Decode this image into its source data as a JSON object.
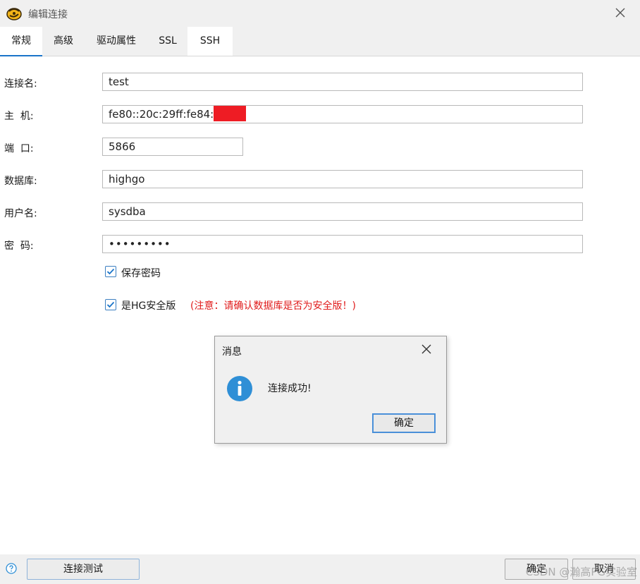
{
  "window": {
    "title": "编辑连接",
    "close_icon": "close-icon"
  },
  "tabs": [
    {
      "label": "常规",
      "active": true
    },
    {
      "label": "高级"
    },
    {
      "label": "驱动属性"
    },
    {
      "label": "SSL"
    },
    {
      "label": "SSH"
    }
  ],
  "form": {
    "conn_name": {
      "label": "连接名:",
      "value": "test"
    },
    "host": {
      "label": "主  机:",
      "value": "fe80::20c:29ff:fe84:"
    },
    "port": {
      "label": "端  口:",
      "value": "5866"
    },
    "database": {
      "label": "数据库:",
      "value": "highgo"
    },
    "username": {
      "label": "用户名:",
      "value": "sysdba"
    },
    "password": {
      "label": "密  码:",
      "value": "•••••••••"
    },
    "save_password": {
      "label": "保存密码",
      "checked": true
    },
    "hg_secure": {
      "label": "是HG安全版",
      "checked": true,
      "note": "(注意：请确认数据库是否为安全版！)"
    }
  },
  "dialog": {
    "title": "消息",
    "message": "连接成功!",
    "ok_label": "确定"
  },
  "bottom": {
    "test_label": "连接测试",
    "ok_label": "确定",
    "cancel_label": "取消"
  },
  "watermark": "CSDN @瀚高PG实验室",
  "colors": {
    "accent": "#1a74c9",
    "warning": "#e01b1b",
    "info": "#2f8fd6",
    "redaction": "#ee1c24"
  }
}
